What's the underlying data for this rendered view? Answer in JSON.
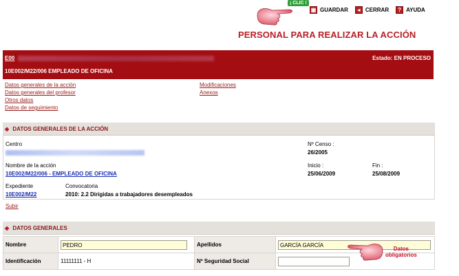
{
  "toolbar": {
    "clic_badge": "¡ CLIC !",
    "buttons": [
      {
        "label": "GUARDAR",
        "icon": "save-icon"
      },
      {
        "label": "CERRAR",
        "icon": "back-arrow-icon"
      },
      {
        "label": "AYUDA",
        "icon": "help-icon"
      }
    ]
  },
  "page_title": "PERSONAL PARA REALIZAR LA ACCIÓN",
  "header": {
    "code": "E00",
    "estado": "Estado: EN PROCESO",
    "subtitle": "10E002/M22/006 EMPLEADO DE OFICINA"
  },
  "nav_links": {
    "left": [
      "Datos generales de la acción",
      "Datos generales del profesor",
      "Otros datos",
      "Datos de seguimiento"
    ],
    "right": [
      "Modificaciones",
      "Anexos"
    ]
  },
  "section1": {
    "title": "DATOS GENERALES DE LA ACCIÓN",
    "centro_label": "Centro",
    "censo_label": "Nº Censo :",
    "censo_value": "26/2005",
    "nombre_accion_label": "Nombre de la acción",
    "nombre_accion_value": "10E002/M22/006 - EMPLEADO DE OFICINA",
    "inicio_label": "Inicio :",
    "inicio_value": "25/06/2009",
    "fin_label": "Fin :",
    "fin_value": "25/08/2009",
    "expediente_label": "Expediente",
    "expediente_value": "10E002/M22",
    "convocatoria_label": "Convocatoria",
    "convocatoria_value": "2010: 2.2 Dirigidas a trabajadores desempleados",
    "subir": "Subir"
  },
  "section2": {
    "title": "DATOS GENERALES",
    "nombre_label": "Nombre",
    "nombre_value": "PEDRO",
    "apellidos_label": "Apellidos",
    "apellidos_value": "GARCÍA GARCÍA",
    "identificacion_label": "Identificación",
    "identificacion_value": "11111111 - H",
    "nss_label": "Nº Seguridad Social",
    "nss_value": ""
  },
  "annotation": {
    "line1": "Datos",
    "line2": "obligatorios"
  },
  "colors": {
    "brand_red": "#a40d12",
    "title_red": "#b81d24",
    "required_field": "#fffdd8",
    "link_blue": "#1a2fb0"
  }
}
